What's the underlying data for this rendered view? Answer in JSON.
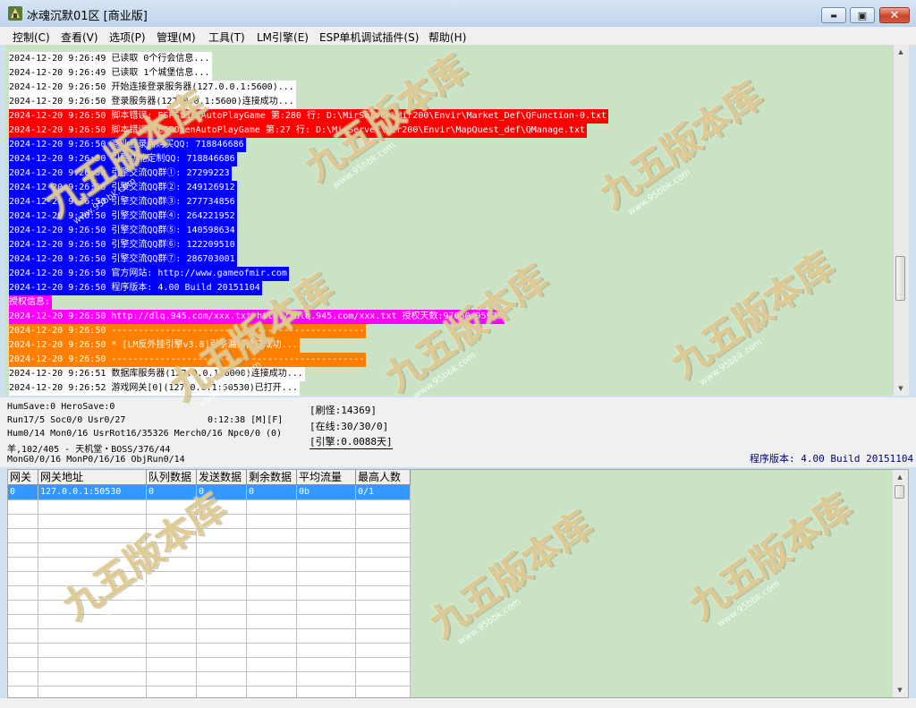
{
  "window": {
    "title": "冰魂沉默01区 [商业版]",
    "min_glyph": "▬",
    "max_glyph": "▣",
    "close_glyph": "✕"
  },
  "menu": [
    "控制(C)",
    "查看(V)",
    "选项(P)",
    "管理(M)",
    "工具(T)",
    "LM引擎(E)",
    "ESP单机调试插件(S)",
    "帮助(H)"
  ],
  "log": {
    "lines": [
      {
        "text": "2024-12-20 9:26:49 已读取 0个行会信息...",
        "fg": "#000000",
        "bg": "#ffffff"
      },
      {
        "text": "2024-12-20 9:26:49 已读取 1个城堡信息...",
        "fg": "#000000",
        "bg": "#ffffff"
      },
      {
        "text": "2024-12-20 9:26:50 开始连接登录服务器(127.0.0.1:5600)...",
        "fg": "#000000",
        "bg": "#ffffff"
      },
      {
        "text": "2024-12-20 9:26:50 登录服务器(127.0.0.1:5600)连接成功...",
        "fg": "#000000",
        "bg": "#ffffff"
      },
      {
        "text": "2024-12-20 9:26:50 脚本错误: ESPStartAutoPlayGame 第:280 行: D:\\MirServer\\Mir200\\Envir\\Market_Def\\QFunction-0.txt",
        "fg": "#ffffff",
        "bg": "#ff0000"
      },
      {
        "text": "2024-12-20 9:26:50 脚本错误: ESPOpenAutoPlayGame 第:27 行: D:\\MirServer\\Mir200\\Envir\\MapQuest_def\\QManage.txt",
        "fg": "#ffffff",
        "bg": "#ff0000"
      },
      {
        "text": "2024-12-20 9:26:50 商业登录器购买QQ: 718846686",
        "fg": "#ffffff",
        "bg": "#0000ff"
      },
      {
        "text": "2024-12-20 9:26:50 引擎功能定制QQ: 718846686",
        "fg": "#ffffff",
        "bg": "#0000ff"
      },
      {
        "text": "2024-12-20 9:26:50 引擎交流QQ群①: 27299223",
        "fg": "#ffffff",
        "bg": "#0000ff"
      },
      {
        "text": "2024-12-20 9:26:50 引擎交流QQ群②: 249126912",
        "fg": "#ffffff",
        "bg": "#0000ff"
      },
      {
        "text": "2024-12-20 9:26:50 引擎交流QQ群③: 277734856",
        "fg": "#ffffff",
        "bg": "#0000ff"
      },
      {
        "text": "2024-12-20 9:26:50 引擎交流QQ群④: 264221952",
        "fg": "#ffffff",
        "bg": "#0000ff"
      },
      {
        "text": "2024-12-20 9:26:50 引擎交流QQ群⑤: 140598634",
        "fg": "#ffffff",
        "bg": "#0000ff"
      },
      {
        "text": "2024-12-20 9:26:50 引擎交流QQ群⑥: 122209510",
        "fg": "#ffffff",
        "bg": "#0000ff"
      },
      {
        "text": "2024-12-20 9:26:50 引擎交流QQ群⑦: 286703001",
        "fg": "#ffffff",
        "bg": "#0000ff"
      },
      {
        "text": "2024-12-20 9:26:50 官方网站: http://www.gameofmir.com",
        "fg": "#ffffff",
        "bg": "#0000ff"
      },
      {
        "text": "2024-12-20 9:26:50 程序版本: 4.00 Build 20151104",
        "fg": "#ffffff",
        "bg": "#0000ff"
      },
      {
        "text": "授权信息:",
        "fg": "#ffffff",
        "bg": "#ff00ff"
      },
      {
        "text": "2024-12-20 9:26:50 http://dlq.945.com/xxx.txt http://dlq.945.com/xxx.txt 授权天数:97650/95939",
        "fg": "#ffffff",
        "bg": "#ff00ff"
      },
      {
        "text": "2024-12-20 9:26:50 -----------------------------------------------",
        "fg": "#ffffff",
        "bg": "#ff8000"
      },
      {
        "text": "2024-12-20 9:26:50 * [LM反外挂引擎v3.8]引擎漏洞修复成功...",
        "fg": "#ffffff",
        "bg": "#ff8000"
      },
      {
        "text": "2024-12-20 9:26:50 -----------------------------------------------",
        "fg": "#ffffff",
        "bg": "#ff8000"
      },
      {
        "text": "2024-12-20 9:26:51 数据库服务器(127.0.0.1:6000)连接成功...",
        "fg": "#000000",
        "bg": "#ffffff"
      },
      {
        "text": "2024-12-20 9:26:52 游戏网关[0](127.0.0.1:50530)已打开...",
        "fg": "#000000",
        "bg": "#ffffff"
      }
    ]
  },
  "status": {
    "line1": "HumSave:0 HeroSave:0",
    "line2": "Run17/5 Soc0/0 Usr0/27",
    "timer": "0:12:38 [M][F]",
    "line3": "Hum0/14 Mon0/16 UsrRot16/35326 Merch0/16 Npc0/0 (0)",
    "line4": "羊,102/405 - 天机堂・BOSS/376/44",
    "line5": "MonG0/0/16 MonP0/16/16 ObjRun0/14",
    "refresh": "[刷怪:14369]",
    "online": "[在线:30/30/0]",
    "engine": "[引擎:0.0088天]",
    "version": "程序版本: 4.00 Build 20151104"
  },
  "gate_table": {
    "headers": [
      "网关",
      "网关地址",
      "队列数据",
      "发送数据",
      "剩余数据",
      "平均流量",
      "最高人数"
    ],
    "rows": [
      [
        "0",
        "127.0.0.1:50530",
        "0",
        "0",
        "0",
        "0b",
        "0/1"
      ]
    ]
  },
  "watermark": {
    "text": "九五版本库",
    "url": "www.95bbk.com"
  },
  "colors": {
    "log_background": "#c9e3c4",
    "selected_row": "#3399ff",
    "version_text": "#000080"
  }
}
